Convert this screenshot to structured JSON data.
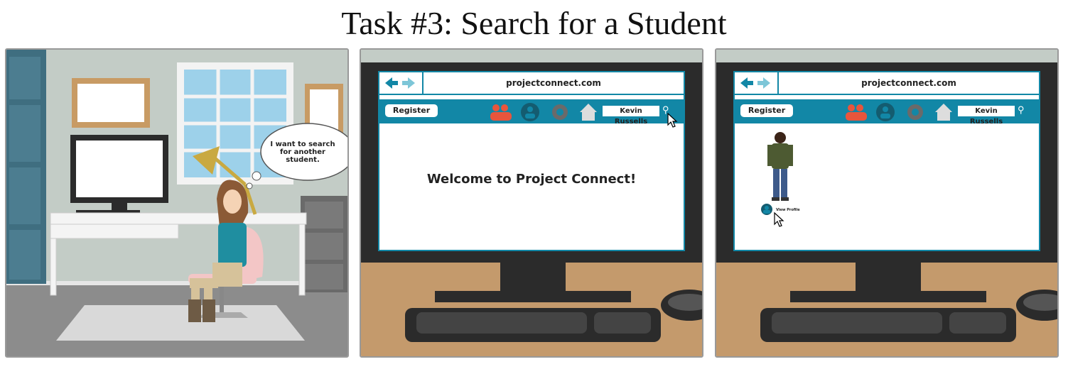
{
  "title": "Task #3: Search for a Student",
  "panel1": {
    "thought_bubble": "I want to search for another student."
  },
  "panel2": {
    "url": "projectconnect.com",
    "register_label": "Register",
    "search_value": "Kevin Russells",
    "welcome_text": "Welcome to Project Connect!"
  },
  "panel3": {
    "url": "projectconnect.com",
    "register_label": "Register",
    "search_value": "Kevin Russells",
    "view_profile_label": "View Profile"
  },
  "colors": {
    "accent": "#1287a6",
    "wall": "#c3ccc6",
    "desk_wood": "#c49a6c",
    "monitor": "#2b2b2b"
  },
  "icons": [
    "back-arrow-icon",
    "forward-arrow-icon",
    "people-icon",
    "user-icon",
    "gear-icon",
    "home-icon",
    "search-icon",
    "cursor-icon"
  ]
}
